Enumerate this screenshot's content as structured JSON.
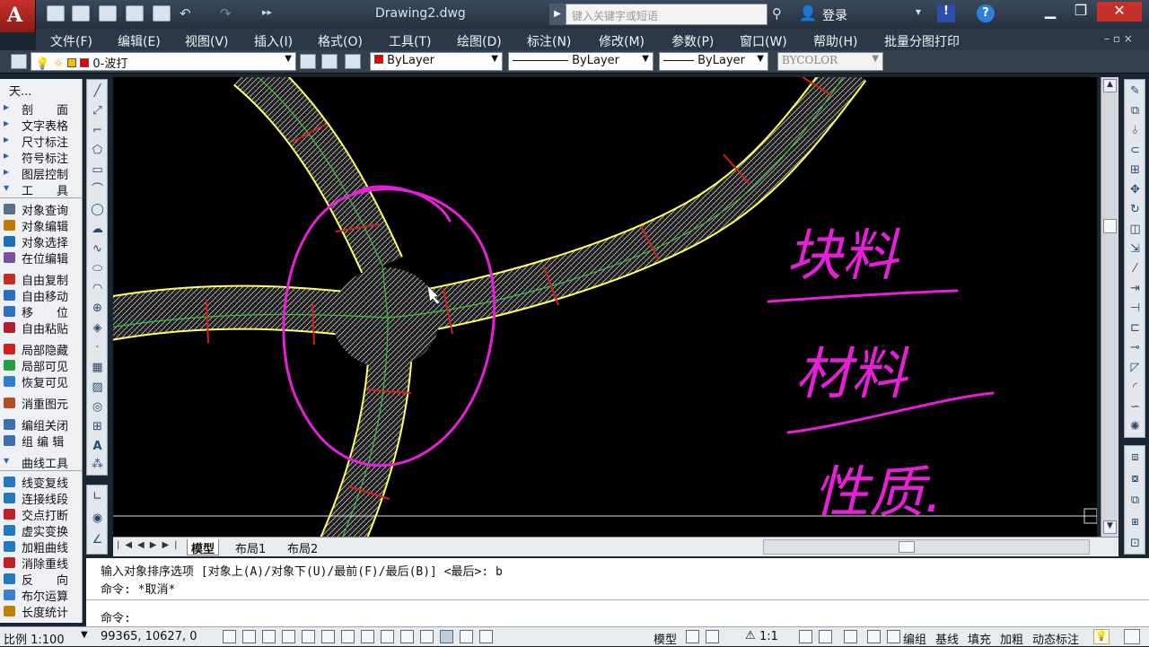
{
  "window": {
    "title": "Drawing2.dwg",
    "search_placeholder": "键入关键字或短语",
    "login": "登录",
    "app_letter": "A"
  },
  "menu": [
    "文件(F)",
    "编辑(E)",
    "视图(V)",
    "插入(I)",
    "格式(O)",
    "工具(T)",
    "绘图(D)",
    "标注(N)",
    "修改(M)",
    "参数(P)",
    "窗口(W)",
    "帮助(H)",
    "批量分图打印"
  ],
  "toolbar": {
    "layer": "0-波打",
    "color": "ByLayer",
    "linetype": "ByLayer",
    "lineweight": "ByLayer",
    "plotstyle": "BYCOLOR"
  },
  "left_panel": {
    "header": "天...",
    "items": [
      {
        "label": "剖　　面",
        "icon": "triangle-icon"
      },
      {
        "label": "文字表格",
        "icon": "triangle-icon"
      },
      {
        "label": "尺寸标注",
        "icon": "triangle-icon"
      },
      {
        "label": "符号标注",
        "icon": "triangle-icon"
      },
      {
        "label": "图层控制",
        "icon": "triangle-icon"
      },
      {
        "label": "工　　具",
        "icon": "triangle-down-icon"
      },
      {
        "label": "对象查询",
        "icon": "query-icon"
      },
      {
        "label": "对象编辑",
        "icon": "edit-icon"
      },
      {
        "label": "对象选择",
        "icon": "select-icon"
      },
      {
        "label": "在位编辑",
        "icon": "inplace-icon"
      },
      {
        "label": "自由复制",
        "icon": "copy-icon"
      },
      {
        "label": "自由移动",
        "icon": "move-icon"
      },
      {
        "label": "移　　位",
        "icon": "shift-icon"
      },
      {
        "label": "自由粘贴",
        "icon": "paste-icon"
      },
      {
        "label": "局部隐藏",
        "icon": "hide-icon"
      },
      {
        "label": "局部可见",
        "icon": "show-icon"
      },
      {
        "label": "恢复可见",
        "icon": "restore-icon"
      },
      {
        "label": "消重图元",
        "icon": "dedupe-icon"
      },
      {
        "label": "编组关闭",
        "icon": "group-off-icon"
      },
      {
        "label": "组 编 辑",
        "icon": "group-edit-icon"
      },
      {
        "label": "曲线工具",
        "icon": "triangle-down-icon"
      },
      {
        "label": "线变复线",
        "icon": "polyline-icon"
      },
      {
        "label": "连接线段",
        "icon": "join-icon"
      },
      {
        "label": "交点打断",
        "icon": "break-icon"
      },
      {
        "label": "虚实变换",
        "icon": "dash-icon"
      },
      {
        "label": "加粗曲线",
        "icon": "thick-icon"
      },
      {
        "label": "消除重线",
        "icon": "overkill-icon"
      },
      {
        "label": "反　　向",
        "icon": "reverse-icon"
      },
      {
        "label": "布尔运算",
        "icon": "boolean-icon"
      },
      {
        "label": "长度统计",
        "icon": "length-icon"
      }
    ]
  },
  "handwriting": {
    "line1": "块料",
    "line2": "材料",
    "line3": "性质."
  },
  "layout_tabs": [
    "模型",
    "布局1",
    "布局2"
  ],
  "command": {
    "history1": "输入对象排序选项 [对象上(A)/对象下(U)/最前(F)/最后(B)] <最后>: b",
    "history2": "命令: *取消*",
    "prompt": "命令:"
  },
  "status": {
    "scale": "比例 1:100",
    "coords": "99365, 10627, 0",
    "space": "模型",
    "annot_scale": "1:1",
    "toggles": [
      "编组",
      "基线",
      "填充",
      "加粗",
      "动态标注"
    ]
  }
}
